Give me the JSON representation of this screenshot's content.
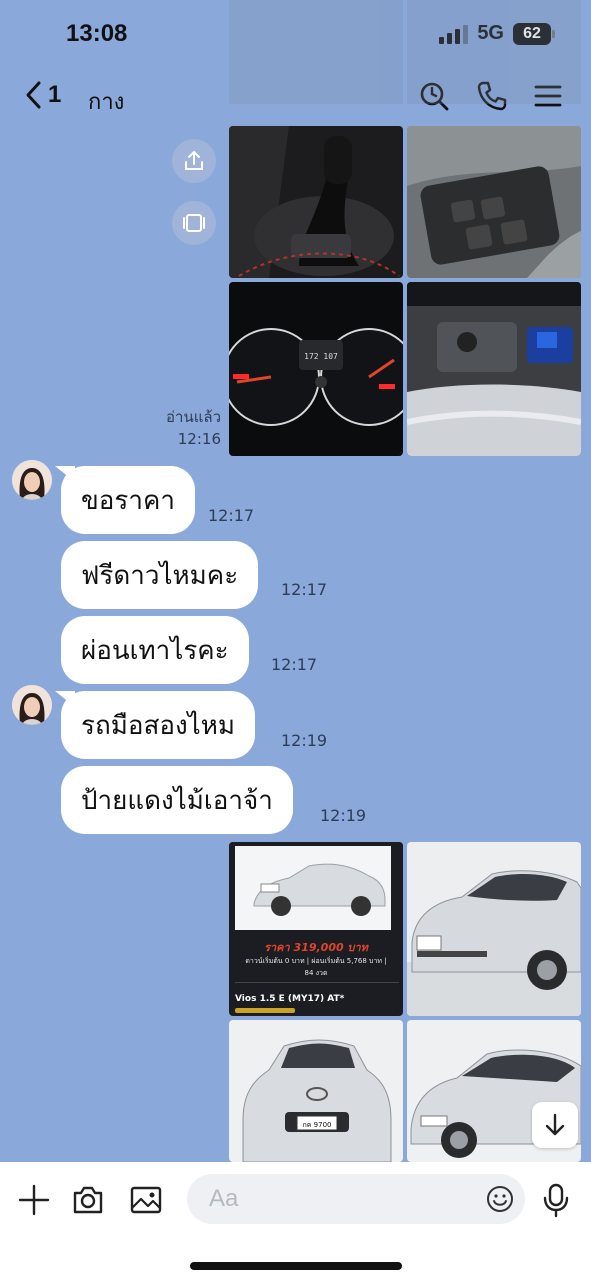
{
  "status_bar": {
    "time": "13:08",
    "network": "5G",
    "battery": "62"
  },
  "header": {
    "back_count": "1",
    "chat_name": "กาง"
  },
  "read_receipt": {
    "label": "อ่านแล้ว",
    "time": "12:16"
  },
  "messages": [
    {
      "text": "ขอราคา",
      "time": "12:17"
    },
    {
      "text": "ฟรีดาวไหมคะ",
      "time": "12:17"
    },
    {
      "text": "ผ่อนเทาไรคะ",
      "time": "12:17"
    },
    {
      "text": "รถมือสองไหม",
      "time": "12:19"
    },
    {
      "text": "ป้ายแดงไม้เอาจ้า",
      "time": "12:19"
    }
  ],
  "ad_card": {
    "price": "ราคา 319,000 บาท",
    "line1": "ดาวน์เริ่มต้น 0 บาท | ผ่อนเริ่มต้น 5,768 บาท |",
    "line2": "84 งวด",
    "model": "Vios 1.5 E (MY17) AT*",
    "plate": "กค 9700"
  },
  "input": {
    "placeholder": "Aa"
  },
  "colors": {
    "chat_background": "#8aa8d9",
    "bubble": "#ffffff",
    "accent_red": "#e0452b"
  },
  "icons": [
    "back-chevron-icon",
    "search-icon",
    "phone-icon",
    "menu-icon",
    "share-icon",
    "album-icon",
    "plus-icon",
    "camera-icon",
    "image-icon",
    "emoji-icon",
    "microphone-icon",
    "arrow-down-icon"
  ]
}
